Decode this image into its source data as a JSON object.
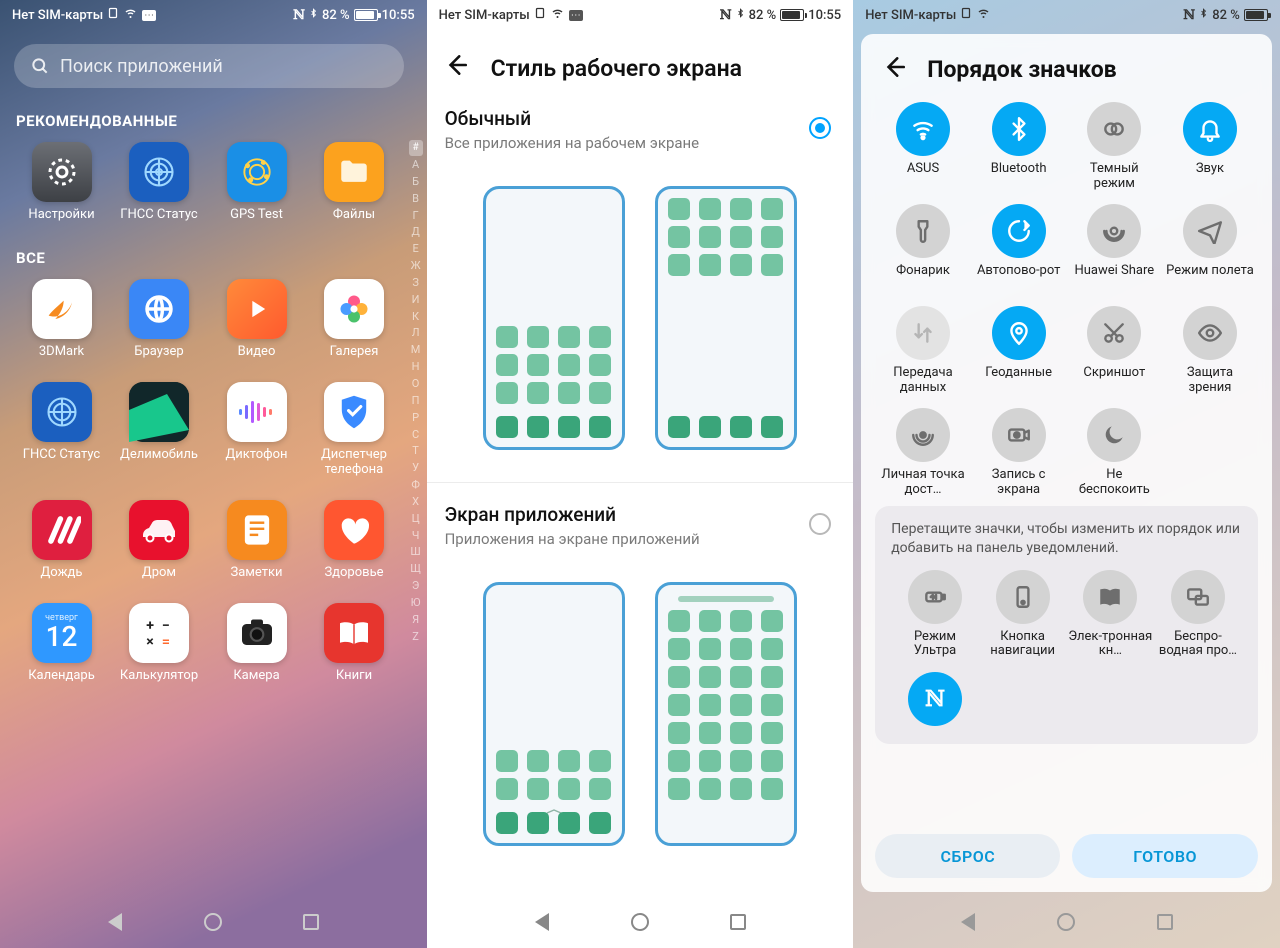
{
  "status": {
    "sim_text": "Нет SIM-карты",
    "battery_pct": "82 %",
    "time1": "10:55",
    "time2": "10:55"
  },
  "phone1": {
    "search_placeholder": "Поиск приложений",
    "section_recommended": "РЕКОМЕНДОВАННЫЕ",
    "section_all": "ВСЕ",
    "alpha_index": [
      "#",
      "А",
      "Б",
      "В",
      "Г",
      "Д",
      "Е",
      "Ж",
      "З",
      "И",
      "К",
      "Л",
      "М",
      "Н",
      "О",
      "П",
      "Р",
      "С",
      "Т",
      "У",
      "Ф",
      "Х",
      "Ц",
      "Ч",
      "Ш",
      "Щ",
      "Э",
      "Ю",
      "Я",
      "Z"
    ],
    "recommended": [
      {
        "id": "settings",
        "label": "Настройки"
      },
      {
        "id": "gnss",
        "label": "ГНСС Статус"
      },
      {
        "id": "gpstest",
        "label": "GPS Test"
      },
      {
        "id": "files",
        "label": "Файлы"
      }
    ],
    "all": [
      {
        "id": "3dmark",
        "label": "3DMark"
      },
      {
        "id": "browser",
        "label": "Браузер"
      },
      {
        "id": "video",
        "label": "Видео"
      },
      {
        "id": "gallery",
        "label": "Галерея"
      },
      {
        "id": "gnss",
        "label": "ГНСС Статус"
      },
      {
        "id": "deli",
        "label": "Делимобиль"
      },
      {
        "id": "dictof",
        "label": "Диктофон"
      },
      {
        "id": "phonemgr",
        "label": "Диспетчер телефона"
      },
      {
        "id": "rain",
        "label": "Дождь"
      },
      {
        "id": "drom",
        "label": "Дром"
      },
      {
        "id": "notes",
        "label": "Заметки"
      },
      {
        "id": "health",
        "label": "Здоровье"
      },
      {
        "id": "calendar",
        "label": "Календарь",
        "day_word": "четверг",
        "day_num": "12"
      },
      {
        "id": "calc",
        "label": "Калькулятор"
      },
      {
        "id": "camera",
        "label": "Камера"
      },
      {
        "id": "books",
        "label": "Книги"
      }
    ]
  },
  "phone2": {
    "title": "Стиль рабочего экрана",
    "opt1_title": "Обычный",
    "opt1_sub": "Все приложения на рабочем экране",
    "opt2_title": "Экран приложений",
    "opt2_sub": "Приложения на экране приложений",
    "selected": "opt1"
  },
  "phone3": {
    "title": "Порядок значков",
    "hint": "Перетащите значки, чтобы изменить их порядок или добавить на панель уведомлений.",
    "btn_reset": "СБРОС",
    "btn_done": "ГОТОВО",
    "tiles_top": [
      {
        "label": "ASUS",
        "state": "on",
        "icon": "wifi"
      },
      {
        "label": "Bluetooth",
        "state": "on",
        "icon": "bt"
      },
      {
        "label": "Темный режим",
        "state": "off",
        "icon": "dark"
      },
      {
        "label": "Звук",
        "state": "on",
        "icon": "bell"
      },
      {
        "label": "Фонарик",
        "state": "off",
        "icon": "torch"
      },
      {
        "label": "Автопово-рот",
        "state": "on",
        "icon": "rotate"
      },
      {
        "label": "Huawei Share",
        "state": "off",
        "icon": "share"
      },
      {
        "label": "Режим полета",
        "state": "off",
        "icon": "plane"
      },
      {
        "label": "Передача данных",
        "state": "dis",
        "icon": "data"
      },
      {
        "label": "Геоданные",
        "state": "on",
        "icon": "loc"
      },
      {
        "label": "Скриншот",
        "state": "off",
        "icon": "snip"
      },
      {
        "label": "Защита зрения",
        "state": "off",
        "icon": "eye"
      },
      {
        "label": "Личная точка дост…",
        "state": "off",
        "icon": "hotspot"
      },
      {
        "label": "Запись с экрана",
        "state": "off",
        "icon": "rec"
      },
      {
        "label": "Не беспокоить",
        "state": "off",
        "icon": "moon"
      }
    ],
    "tiles_more": [
      {
        "label": "Режим Ультра",
        "icon": "ultra"
      },
      {
        "label": "Кнопка навигации",
        "icon": "navkey"
      },
      {
        "label": "Элек-тронная кн…",
        "icon": "ebook"
      },
      {
        "label": "Беспро-водная про…",
        "icon": "cast"
      }
    ],
    "tiles_extra": [
      {
        "label": "",
        "state": "on",
        "icon": "nfc"
      }
    ]
  }
}
